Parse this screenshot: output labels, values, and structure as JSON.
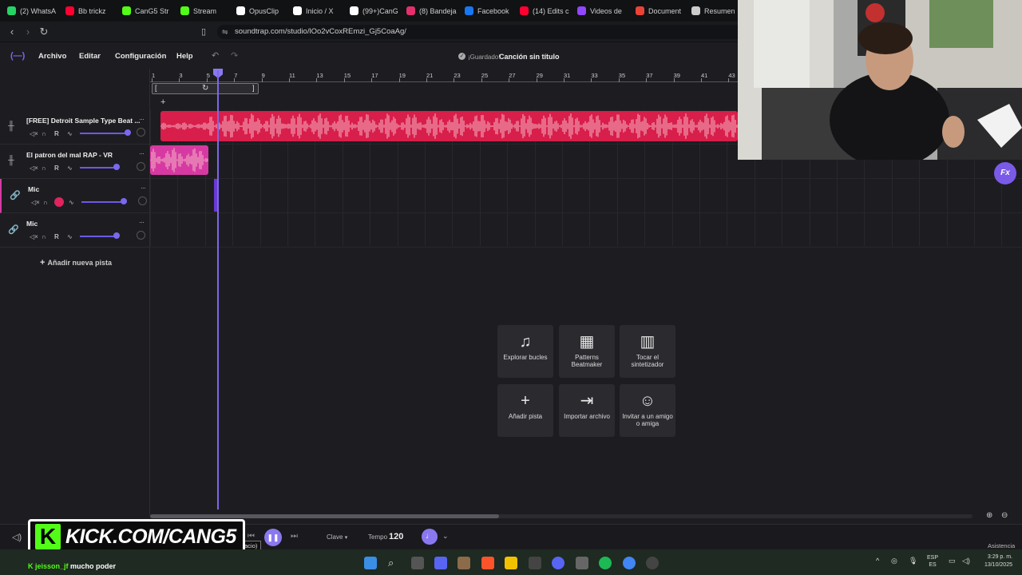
{
  "browser": {
    "tabs": [
      {
        "label": "(2) WhatsA",
        "icon": "whatsapp-icon",
        "color": "#25d366"
      },
      {
        "label": "Bb trickz",
        "icon": "youtube-icon",
        "color": "#ff0033"
      },
      {
        "label": "CanG5 Str",
        "icon": "kick-icon",
        "color": "#53fc18"
      },
      {
        "label": "Stream",
        "icon": "kick-icon",
        "color": "#53fc18"
      },
      {
        "label": "OpusClip",
        "icon": "opusclip-icon",
        "color": "#ffffff"
      },
      {
        "label": "Inicio / X",
        "icon": "x-icon",
        "color": "#ffffff"
      },
      {
        "label": "(99+)CanG",
        "icon": "tiktok-icon",
        "color": "#ffffff"
      },
      {
        "label": "(8) Bandeja",
        "icon": "instagram-icon",
        "color": "#e1306c"
      },
      {
        "label": "Facebook",
        "icon": "facebook-icon",
        "color": "#1877f2"
      },
      {
        "label": "(14) Edits c",
        "icon": "youtube-icon",
        "color": "#ff0033"
      },
      {
        "label": "Videos de",
        "icon": "twitch-icon",
        "color": "#9146ff"
      },
      {
        "label": "Document",
        "icon": "gmail-icon",
        "color": "#ea4335"
      },
      {
        "label": "Resumen",
        "icon": "gear-icon",
        "color": "#cccccc"
      }
    ],
    "url": "soundtrap.com/studio/lOo2vCoxREmzi_Gj5CoaAg/"
  },
  "app": {
    "menu": [
      "Archivo",
      "Editar",
      "Configuración",
      "Help"
    ],
    "saved_label": "¡Guardado!",
    "song_title": "Canción sin título",
    "fx_label": "Fx"
  },
  "tracks": [
    {
      "name": "[FREE] Detroit Sample Type Beat ...",
      "icon": "waveform-icon",
      "volume": 0.85,
      "rec_enabled": false
    },
    {
      "name": "El patron del mal RAP - VR",
      "icon": "waveform-icon",
      "volume": 0.65,
      "rec_enabled": false
    },
    {
      "name": "Mic",
      "icon": "link-icon",
      "volume": 0.75,
      "rec_enabled": true
    },
    {
      "name": "Mic",
      "icon": "link-icon",
      "volume": 0.65,
      "rec_enabled": false
    }
  ],
  "track_ctrl_r": "R",
  "add_track_label": "Añadir nueva pista",
  "ruler_ticks": [
    "1",
    "3",
    "5",
    "7",
    "9",
    "11",
    "13",
    "15",
    "17",
    "19",
    "21",
    "23",
    "25",
    "27",
    "29",
    "31",
    "33",
    "35",
    "37",
    "39",
    "41",
    "43"
  ],
  "tiles": [
    {
      "icon": "music-note-icon",
      "label": "Explorar bucles",
      "glyph": "♫"
    },
    {
      "icon": "grid-icon",
      "label": "Patterns Beatmaker",
      "glyph": "▦"
    },
    {
      "icon": "piano-icon",
      "label": "Tocar el sintetizador",
      "glyph": "▥"
    },
    {
      "icon": "plus-icon",
      "label": "Añadir pista",
      "glyph": "+"
    },
    {
      "icon": "import-icon",
      "label": "Importar archivo",
      "glyph": "⇥"
    },
    {
      "icon": "invite-user-icon",
      "label": "Invitar a un amigo o amiga",
      "glyph": "☺"
    }
  ],
  "transport": {
    "shortcut_tooltip": "Ctrl + Espacio)",
    "key_label": "Clave",
    "tempo_label": "Tempo",
    "tempo_value": "120",
    "assistance": "Asistencia"
  },
  "overlay": {
    "kick_banner": "KICK.COM/CANG5",
    "chat_user": "jeisson_jf",
    "chat_message": "mucho poder"
  },
  "taskbar": {
    "lang_top": "ESP",
    "lang_bottom": "ES",
    "time": "3:29 p. m.",
    "date": "13/10/2025"
  },
  "colors": {
    "accent": "#6c5ae6",
    "clip_red": "#d81e4a",
    "clip_pink": "#d63aa2",
    "record": "#e0245e",
    "background": "#1d1d21"
  }
}
